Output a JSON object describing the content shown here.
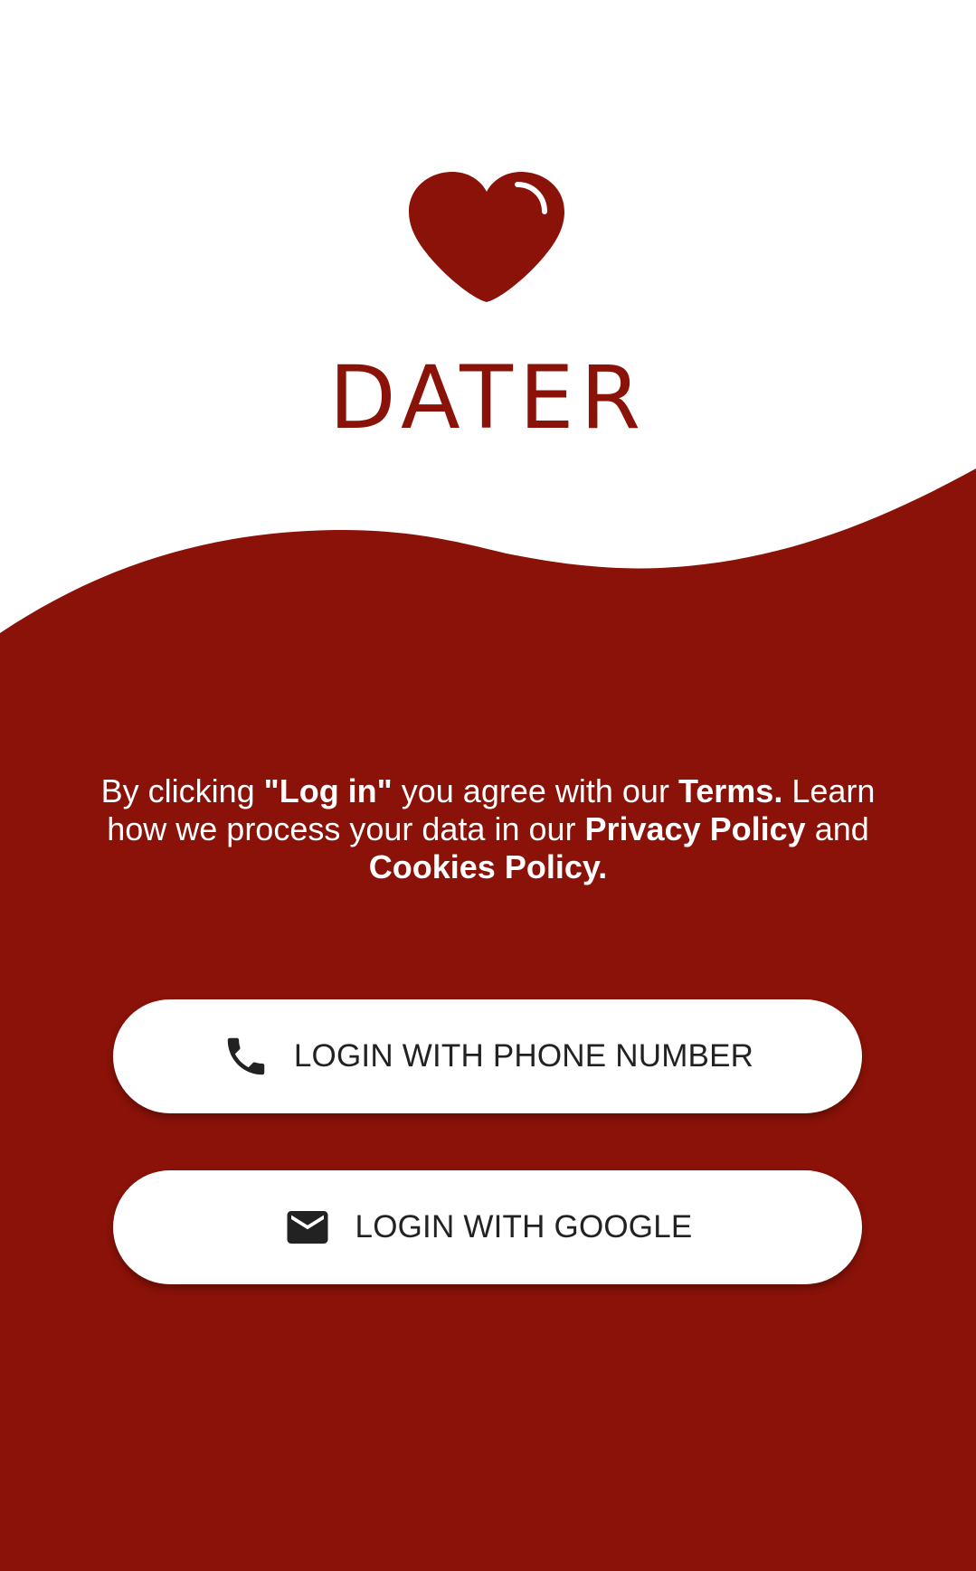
{
  "app": {
    "name": "DATER"
  },
  "colors": {
    "brand": "#8a1208",
    "background_top": "#ffffff",
    "button_bg": "#ffffff",
    "button_text": "#222222"
  },
  "icons": {
    "logo": "heart-icon",
    "phone_button": "phone-icon",
    "google_button": "mail-icon"
  },
  "terms": {
    "part1": "By clicking ",
    "login_quote": "\"Log in\"",
    "part2": " you agree with our ",
    "terms_link": "Terms.",
    "part3": " Learn how  we process your data in our ",
    "privacy_link": "Privacy Policy",
    "part4": " and ",
    "cookies_link": "Cookies Policy."
  },
  "buttons": {
    "phone_label": "LOGIN WITH PHONE NUMBER",
    "google_label": "LOGIN WITH GOOGLE"
  }
}
